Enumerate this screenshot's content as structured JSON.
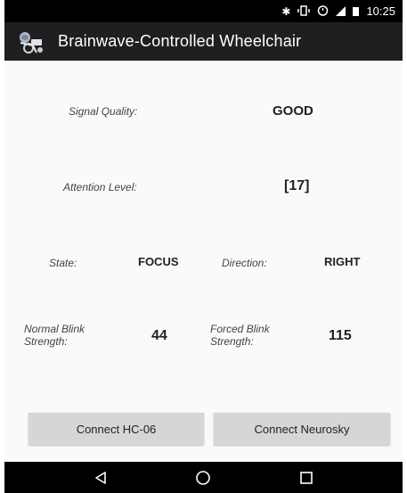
{
  "status_bar": {
    "time": "10:25",
    "icons": [
      "bluetooth-icon",
      "vibrate-icon",
      "alarm-icon",
      "cell-signal-icon",
      "battery-icon"
    ]
  },
  "app_bar": {
    "title": "Brainwave-Controlled Wheelchair",
    "icon": "wheelchair-app-icon"
  },
  "signal_quality": {
    "label": "Signal Quality:",
    "value": "GOOD"
  },
  "attention_level": {
    "label": "Attention Level:",
    "value": "[17]"
  },
  "state": {
    "label": "State:",
    "value": "FOCUS"
  },
  "direction": {
    "label": "Direction:",
    "value": "RIGHT"
  },
  "normal_blink": {
    "label_line1": "Normal Blink",
    "label_line2": "Strength:",
    "value": "44"
  },
  "forced_blink": {
    "label_line1": "Forced Blink",
    "label_line2": "Strength:",
    "value": "115"
  },
  "buttons": {
    "connect_hc06": "Connect HC-06",
    "connect_neurosky": "Connect Neurosky"
  },
  "nav_bar": {
    "icons": [
      "back-icon",
      "home-icon",
      "recents-icon"
    ]
  }
}
